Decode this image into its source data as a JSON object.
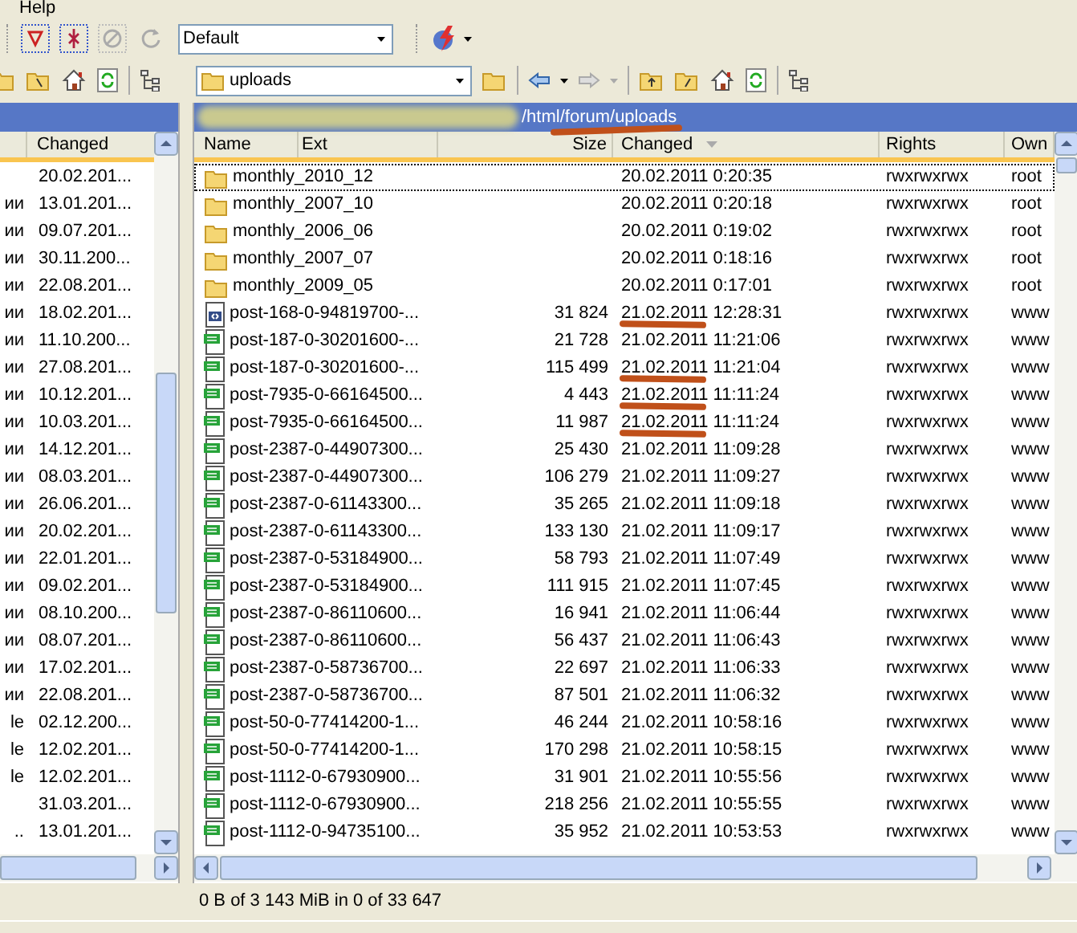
{
  "menubar": {
    "items": [
      "Help"
    ]
  },
  "toolbar": {
    "filter_preset": "Default"
  },
  "left_panel": {
    "columns": [
      {
        "label": "Changed"
      }
    ],
    "rows": [
      {
        "column_1": "",
        "changed": "20.02.201..."
      },
      {
        "column_1": "ии",
        "changed": "13.01.201..."
      },
      {
        "column_1": "ии",
        "changed": "09.07.201..."
      },
      {
        "column_1": "ии",
        "changed": "30.11.200..."
      },
      {
        "column_1": "ии",
        "changed": "22.08.201..."
      },
      {
        "column_1": "ии",
        "changed": "18.02.201..."
      },
      {
        "column_1": "ии",
        "changed": "11.10.200..."
      },
      {
        "column_1": "ии",
        "changed": "27.08.201..."
      },
      {
        "column_1": "ии",
        "changed": "10.12.201..."
      },
      {
        "column_1": "ии",
        "changed": "10.03.201..."
      },
      {
        "column_1": "ии",
        "changed": "14.12.201..."
      },
      {
        "column_1": "ии",
        "changed": "08.03.201..."
      },
      {
        "column_1": "ии",
        "changed": "26.06.201..."
      },
      {
        "column_1": "ии",
        "changed": "20.02.201..."
      },
      {
        "column_1": "ии",
        "changed": "22.01.201..."
      },
      {
        "column_1": "ии",
        "changed": "09.02.201..."
      },
      {
        "column_1": "ии",
        "changed": "08.10.200..."
      },
      {
        "column_1": "ии",
        "changed": "08.07.201..."
      },
      {
        "column_1": "ии",
        "changed": "17.02.201..."
      },
      {
        "column_1": "ии",
        "changed": "22.08.201..."
      },
      {
        "column_1": "le",
        "changed": "02.12.200..."
      },
      {
        "column_1": "le",
        "changed": "12.02.201..."
      },
      {
        "column_1": "le",
        "changed": "12.02.201..."
      },
      {
        "column_1": "",
        "changed": "31.03.201..."
      },
      {
        "column_1": "..",
        "changed": "13.01.201..."
      }
    ]
  },
  "right_panel": {
    "location": "uploads",
    "path": "/html/forum/uploads",
    "path_underlined": true,
    "columns": [
      {
        "label": "Name"
      },
      {
        "label": "Ext"
      },
      {
        "label": "Size"
      },
      {
        "label": "Changed",
        "sorted": true
      },
      {
        "label": "Rights"
      },
      {
        "label": "Own"
      }
    ],
    "rows": [
      {
        "kind": "folder",
        "name": "monthly_2010_12",
        "size": "",
        "changed": "20.02.2011 0:20:35",
        "rights": "rwxrwxrwx",
        "owner": "root",
        "focused": true,
        "underlined": false
      },
      {
        "kind": "folder",
        "name": "monthly_2007_10",
        "size": "",
        "changed": "20.02.2011 0:20:18",
        "rights": "rwxrwxrwx",
        "owner": "root",
        "focused": false,
        "underlined": false
      },
      {
        "kind": "folder",
        "name": "monthly_2006_06",
        "size": "",
        "changed": "20.02.2011 0:19:02",
        "rights": "rwxrwxrwx",
        "owner": "root",
        "focused": false,
        "underlined": false
      },
      {
        "kind": "folder",
        "name": "monthly_2007_07",
        "size": "",
        "changed": "20.02.2011 0:18:16",
        "rights": "rwxrwxrwx",
        "owner": "root",
        "focused": false,
        "underlined": false
      },
      {
        "kind": "folder",
        "name": "monthly_2009_05",
        "size": "",
        "changed": "20.02.2011 0:17:01",
        "rights": "rwxrwxrwx",
        "owner": "root",
        "focused": false,
        "underlined": false
      },
      {
        "kind": "document",
        "name": "post-168-0-94819700-...",
        "size": "31 824",
        "changed": "21.02.2011 12:28:31",
        "rights": "rwxrwxrwx",
        "owner": "www",
        "focused": false,
        "underlined": true
      },
      {
        "kind": "image",
        "name": "post-187-0-30201600-...",
        "size": "21 728",
        "changed": "21.02.2011 11:21:06",
        "rights": "rwxrwxrwx",
        "owner": "www",
        "focused": false,
        "underlined": false
      },
      {
        "kind": "image",
        "name": "post-187-0-30201600-...",
        "size": "115 499",
        "changed": "21.02.2011 11:21:04",
        "rights": "rwxrwxrwx",
        "owner": "www",
        "focused": false,
        "underlined": true
      },
      {
        "kind": "image",
        "name": "post-7935-0-66164500...",
        "size": "4 443",
        "changed": "21.02.2011 11:11:24",
        "rights": "rwxrwxrwx",
        "owner": "www",
        "focused": false,
        "underlined": true
      },
      {
        "kind": "image",
        "name": "post-7935-0-66164500...",
        "size": "11 987",
        "changed": "21.02.2011 11:11:24",
        "rights": "rwxrwxrwx",
        "owner": "www",
        "focused": false,
        "underlined": true
      },
      {
        "kind": "image",
        "name": "post-2387-0-44907300...",
        "size": "25 430",
        "changed": "21.02.2011 11:09:28",
        "rights": "rwxrwxrwx",
        "owner": "www",
        "focused": false,
        "underlined": false
      },
      {
        "kind": "image",
        "name": "post-2387-0-44907300...",
        "size": "106 279",
        "changed": "21.02.2011 11:09:27",
        "rights": "rwxrwxrwx",
        "owner": "www",
        "focused": false,
        "underlined": false
      },
      {
        "kind": "image",
        "name": "post-2387-0-61143300...",
        "size": "35 265",
        "changed": "21.02.2011 11:09:18",
        "rights": "rwxrwxrwx",
        "owner": "www",
        "focused": false,
        "underlined": false
      },
      {
        "kind": "image",
        "name": "post-2387-0-61143300...",
        "size": "133 130",
        "changed": "21.02.2011 11:09:17",
        "rights": "rwxrwxrwx",
        "owner": "www",
        "focused": false,
        "underlined": false
      },
      {
        "kind": "image",
        "name": "post-2387-0-53184900...",
        "size": "58 793",
        "changed": "21.02.2011 11:07:49",
        "rights": "rwxrwxrwx",
        "owner": "www",
        "focused": false,
        "underlined": false
      },
      {
        "kind": "image",
        "name": "post-2387-0-53184900...",
        "size": "111 915",
        "changed": "21.02.2011 11:07:45",
        "rights": "rwxrwxrwx",
        "owner": "www",
        "focused": false,
        "underlined": false
      },
      {
        "kind": "image",
        "name": "post-2387-0-86110600...",
        "size": "16 941",
        "changed": "21.02.2011 11:06:44",
        "rights": "rwxrwxrwx",
        "owner": "www",
        "focused": false,
        "underlined": false
      },
      {
        "kind": "image",
        "name": "post-2387-0-86110600...",
        "size": "56 437",
        "changed": "21.02.2011 11:06:43",
        "rights": "rwxrwxrwx",
        "owner": "www",
        "focused": false,
        "underlined": false
      },
      {
        "kind": "image",
        "name": "post-2387-0-58736700...",
        "size": "22 697",
        "changed": "21.02.2011 11:06:33",
        "rights": "rwxrwxrwx",
        "owner": "www",
        "focused": false,
        "underlined": false
      },
      {
        "kind": "image",
        "name": "post-2387-0-58736700...",
        "size": "87 501",
        "changed": "21.02.2011 11:06:32",
        "rights": "rwxrwxrwx",
        "owner": "www",
        "focused": false,
        "underlined": false
      },
      {
        "kind": "image",
        "name": "post-50-0-77414200-1...",
        "size": "46 244",
        "changed": "21.02.2011 10:58:16",
        "rights": "rwxrwxrwx",
        "owner": "www",
        "focused": false,
        "underlined": false
      },
      {
        "kind": "image",
        "name": "post-50-0-77414200-1...",
        "size": "170 298",
        "changed": "21.02.2011 10:58:15",
        "rights": "rwxrwxrwx",
        "owner": "www",
        "focused": false,
        "underlined": false
      },
      {
        "kind": "image",
        "name": "post-1112-0-67930900...",
        "size": "31 901",
        "changed": "21.02.2011 10:55:56",
        "rights": "rwxrwxrwx",
        "owner": "www",
        "focused": false,
        "underlined": false
      },
      {
        "kind": "image",
        "name": "post-1112-0-67930900...",
        "size": "218 256",
        "changed": "21.02.2011 10:55:55",
        "rights": "rwxrwxrwx",
        "owner": "www",
        "focused": false,
        "underlined": false
      },
      {
        "kind": "image",
        "name": "post-1112-0-94735100...",
        "size": "35 952",
        "changed": "21.02.2011 10:53:53",
        "rights": "rwxrwxrwx",
        "owner": "www",
        "focused": false,
        "underlined": false
      }
    ]
  },
  "status_bar": "0 B of 3 143 MiB in 0 of 33 647"
}
